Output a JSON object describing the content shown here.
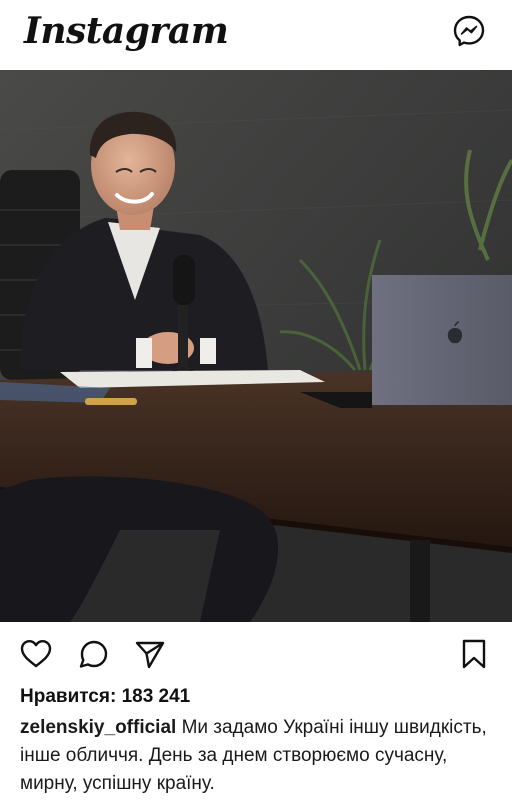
{
  "header": {
    "logo_text": "Instagram",
    "messenger_icon": "messenger-icon"
  },
  "post": {
    "image_subject": "man smiling at desk with laptop and microphone",
    "actions": {
      "like_icon": "heart-icon",
      "comment_icon": "comment-icon",
      "share_icon": "send-icon",
      "save_icon": "bookmark-icon"
    },
    "likes_text": "Нравится: 183 241",
    "username": "zelenskiy_official",
    "caption": "Ми задамо Україні іншу швидкість, інше обличчя. День за днем створюємо сучасну, мирну, успішну країну."
  }
}
